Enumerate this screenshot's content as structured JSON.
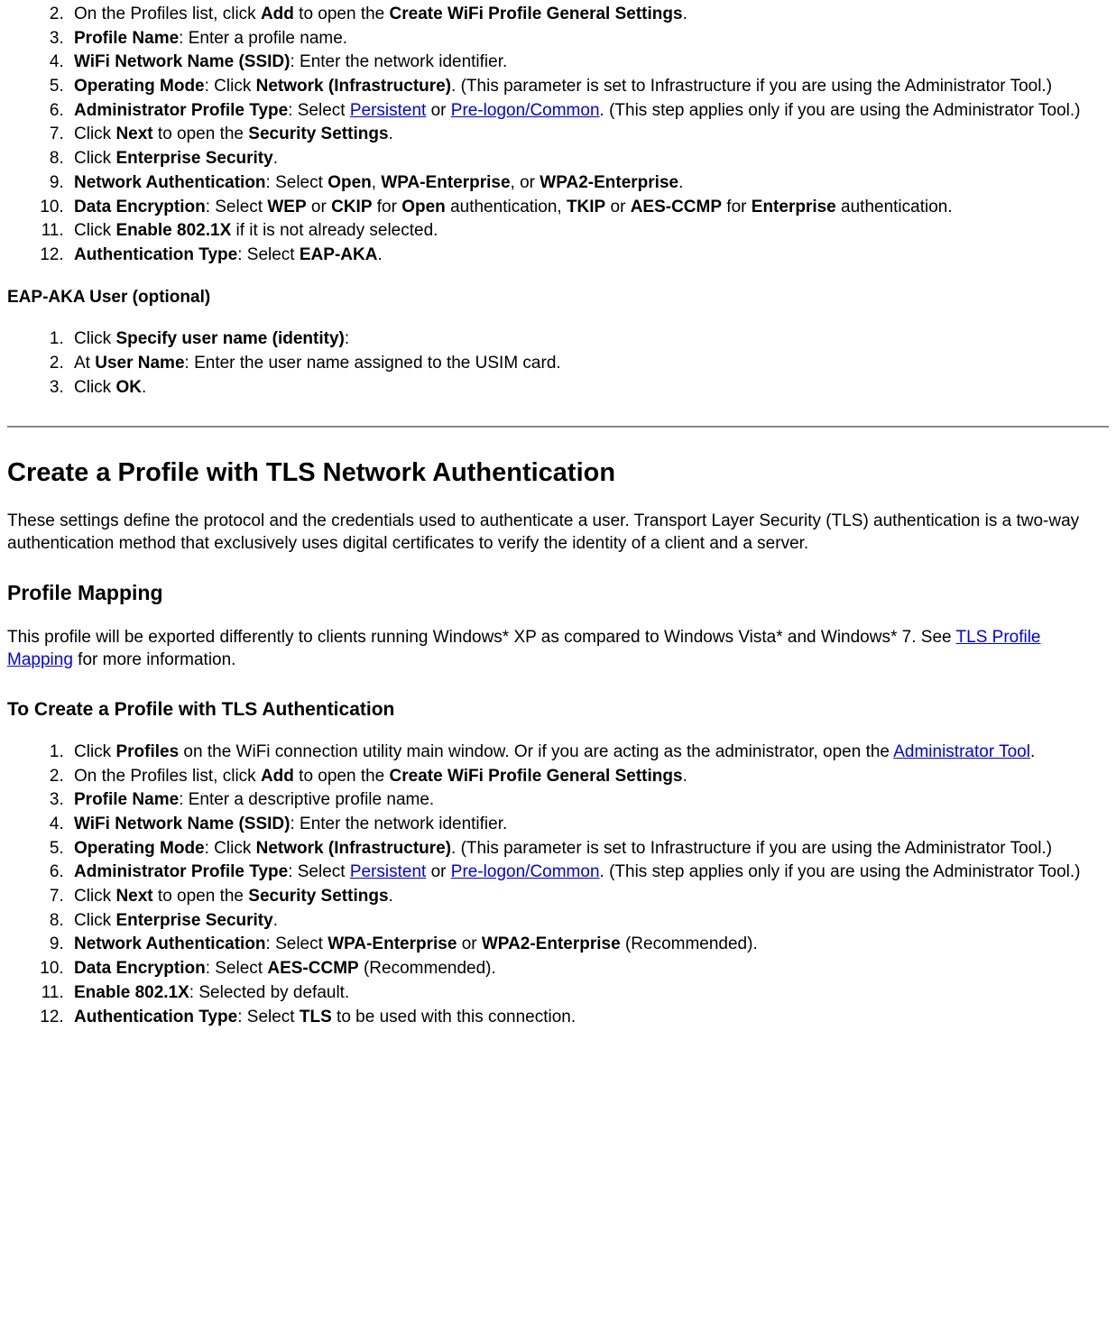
{
  "list1": {
    "start": 2,
    "items": [
      {
        "pre": "On the Profiles list, click ",
        "b1": "Add",
        "mid": " to open the ",
        "b2": "Create WiFi Profile General Settings",
        "post": "."
      },
      {
        "b1": "Profile Name",
        "post": ": Enter a profile name."
      },
      {
        "b1": "WiFi Network Name (SSID)",
        "post": ": Enter the network identifier."
      },
      {
        "b1": "Operating Mode",
        "mid": ": Click ",
        "b2": "Network (Infrastructure)",
        "post": ". (This parameter is set to Infrastructure if you are using the Administrator Tool.)"
      },
      {
        "b1": "Administrator Profile Type",
        "mid": ": Select ",
        "a1": "Persistent",
        "mid2": " or ",
        "a2": "Pre-logon/Common",
        "post": ". (This step applies only if you are using the Administrator Tool.)"
      },
      {
        "pre": "Click ",
        "b1": "Next",
        "mid": " to open the ",
        "b2": "Security Settings",
        "post": "."
      },
      {
        "pre": "Click ",
        "b1": "Enterprise Security",
        "post": "."
      },
      {
        "b1": "Network Authentication",
        "mid": ": Select ",
        "b2": "Open",
        "mid2": ", ",
        "b3": "WPA-Enterprise",
        "mid3": ", or ",
        "b4": "WPA2-Enterprise",
        "post": "."
      },
      {
        "b1": "Data Encryption",
        "mid": ": Select ",
        "b2": "WEP",
        "mid2": " or ",
        "b3": "CKIP",
        "mid3": " for ",
        "b4": "Open",
        "mid4": " authentication, ",
        "b5": "TKIP",
        "mid5": " or ",
        "b6": "AES-CCMP",
        "mid6": " for ",
        "b7": "Enterprise",
        "post": " authentication."
      },
      {
        "pre": "Click ",
        "b1": "Enable 802.1X",
        "post": " if it is not already selected."
      },
      {
        "b1": "Authentication Type",
        "mid": ": Select ",
        "b2": "EAP-AKA",
        "post": "."
      }
    ]
  },
  "section1_heading": "EAP-AKA User (optional)",
  "list2": {
    "items": [
      {
        "pre": "Click ",
        "b1": "Specify user name (identity)",
        "post": ":"
      },
      {
        "pre": "At ",
        "b1": "User Name",
        "post": ": Enter the user name assigned to the USIM card."
      },
      {
        "pre": "Click ",
        "b1": "OK",
        "post": "."
      }
    ]
  },
  "h2_title": "Create a Profile with TLS Network Authentication",
  "tls_para": "These settings define the protocol and the credentials used to authenticate a user. Transport Layer Security (TLS) authentication is a two-way authentication method that exclusively uses digital certificates to verify the identity of a client and a server.",
  "h3_mapping": "Profile Mapping",
  "mapping_para_pre": "This profile will be exported differently to clients running Windows* XP as compared to Windows Vista* and Windows* 7. See ",
  "mapping_link": "TLS Profile Mapping",
  "mapping_para_post": " for more information.",
  "h3_create": "To Create a Profile with TLS Authentication",
  "list3": {
    "items": [
      {
        "pre": "Click ",
        "b1": "Profiles",
        "mid": " on the WiFi connection utility main window. Or if you are acting as the administrator, open the ",
        "a1": "Administrator Tool",
        "post": "."
      },
      {
        "pre": "On the Profiles list, click ",
        "b1": "Add",
        "mid": " to open the ",
        "b2": "Create WiFi Profile General Settings",
        "post": "."
      },
      {
        "b1": "Profile Name",
        "post": ": Enter a descriptive profile name."
      },
      {
        "b1": "WiFi Network Name (SSID)",
        "post": ": Enter the network identifier."
      },
      {
        "b1": "Operating Mode",
        "mid": ": Click ",
        "b2": "Network (Infrastructure)",
        "post": ". (This parameter is set to Infrastructure if you are using the Administrator Tool.)"
      },
      {
        "b1": "Administrator Profile Type",
        "mid": ": Select ",
        "a1": "Persistent",
        "mid2": " or ",
        "a2": "Pre-logon/Common",
        "post": ". (This step applies only if you are using the Administrator Tool.)"
      },
      {
        "pre": "Click ",
        "b1": "Next",
        "mid": " to open the ",
        "b2": "Security Settings",
        "post": "."
      },
      {
        "pre": "Click ",
        "b1": "Enterprise Security",
        "post": "."
      },
      {
        "b1": "Network Authentication",
        "mid": ": Select ",
        "b2": "WPA-Enterprise",
        "mid2": " or ",
        "b3": "WPA2-Enterprise",
        "post": " (Recommended)."
      },
      {
        "b1": "Data Encryption",
        "mid": ": Select ",
        "b2": "AES-CCMP",
        "post": " (Recommended)."
      },
      {
        "b1": "Enable 802.1X",
        "post": ": Selected by default."
      },
      {
        "b1": "Authentication Type",
        "mid": ": Select ",
        "b2": "TLS",
        "post": " to be used with this connection."
      }
    ]
  }
}
